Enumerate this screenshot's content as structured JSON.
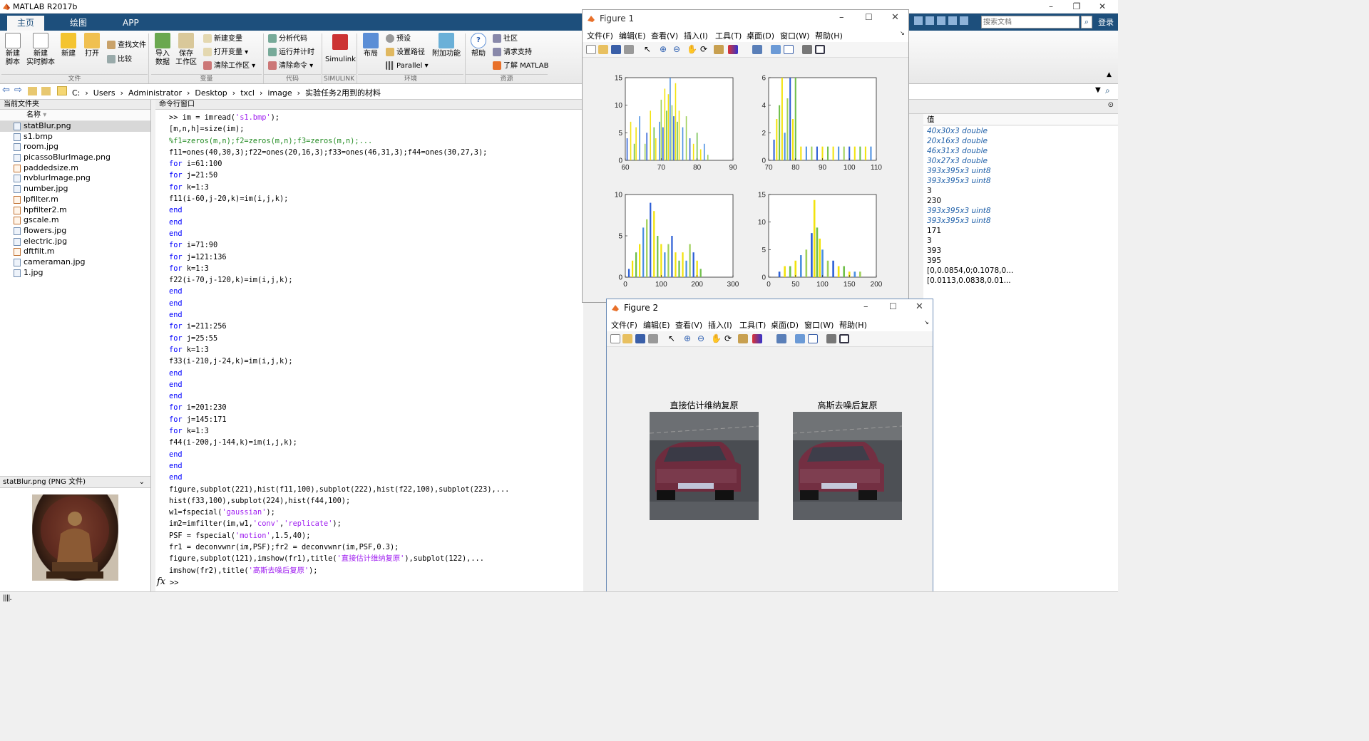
{
  "app": {
    "title": "MATLAB R2017b"
  },
  "ribbon_tabs": [
    "主页",
    "绘图",
    "APP"
  ],
  "ribbon": {
    "groups": [
      "文件",
      "变量",
      "代码",
      "SIMULINK",
      "环境",
      "资源"
    ],
    "big_buttons": [
      {
        "label": "新建\n脚本",
        "icon": "new-script-icon"
      },
      {
        "label": "新建\n实时脚本",
        "icon": "new-live-script-icon"
      },
      {
        "label": "新建",
        "icon": "new-icon"
      },
      {
        "label": "打开",
        "icon": "open-folder-icon"
      },
      {
        "label": "导入\n数据",
        "icon": "import-icon"
      },
      {
        "label": "保存\n工作区",
        "icon": "save-workspace-icon"
      },
      {
        "label": "Simulink",
        "icon": "simulink-icon"
      },
      {
        "label": "布局",
        "icon": "layout-icon"
      },
      {
        "label": "附加功能",
        "icon": "addons-icon"
      },
      {
        "label": "帮助",
        "icon": "help-icon"
      }
    ],
    "small_buttons": {
      "find": "查找文件",
      "compare": "比较",
      "newvar": "新建变量",
      "openvar": "打开变量",
      "clearws": "清除工作区",
      "analyze": "分析代码",
      "runtime": "运行并计时",
      "clearcmd": "清除命令",
      "prefs": "预设",
      "setpath": "设置路径",
      "parallel": "Parallel",
      "community": "社区",
      "support": "请求支持",
      "learn": "了解 MATLAB"
    },
    "search": {
      "placeholder": "搜索文档"
    },
    "login": "登录"
  },
  "address": {
    "crumbs": [
      "C:",
      "Users",
      "Administrator",
      "Desktop",
      "txcl",
      "image",
      "实验任务2用到的材料"
    ]
  },
  "left_panel": {
    "title": "当前文件夹",
    "column": "名称",
    "files": [
      {
        "name": "statBlur.png",
        "selected": true
      },
      {
        "name": "s1.bmp"
      },
      {
        "name": "room.jpg"
      },
      {
        "name": "picassoBlurImage.png"
      },
      {
        "name": "paddedsize.m"
      },
      {
        "name": "nvblurImage.png"
      },
      {
        "name": "number.jpg"
      },
      {
        "name": "lpfilter.m"
      },
      {
        "name": "hpfilter2.m"
      },
      {
        "name": "gscale.m"
      },
      {
        "name": "flowers.jpg"
      },
      {
        "name": "electric.jpg"
      },
      {
        "name": "dftfilt.m"
      },
      {
        "name": "cameraman.jpg"
      },
      {
        "name": "1.jpg"
      }
    ],
    "details_title": "statBlur.png  (PNG 文件)"
  },
  "command_window": {
    "title": "命令行窗口",
    "lines": [
      [
        [
          ">> im = imread(",
          ""
        ],
        [
          "'s1.bmp'",
          "str"
        ],
        [
          ");",
          ""
        ]
      ],
      [
        [
          "[m,n,h]=size(im);",
          ""
        ]
      ],
      [
        [
          "%f1=zeros(m,n);f2=zeros(m,n);f3=zeros(m,n);...",
          "cmt"
        ]
      ],
      [
        [
          "f11=ones(40,30,3);f22=ones(20,16,3);f33=ones(46,31,3);f44=ones(30,27,3);",
          ""
        ]
      ],
      [
        [
          "for ",
          "kw"
        ],
        [
          "i=61:100",
          ""
        ]
      ],
      [
        [
          "for ",
          "kw"
        ],
        [
          "j=21:50",
          ""
        ]
      ],
      [
        [
          "for ",
          "kw"
        ],
        [
          "k=1:3",
          ""
        ]
      ],
      [
        [
          "f11(i-60,j-20,k)=im(i,j,k);",
          ""
        ]
      ],
      [
        [
          "end",
          "kw"
        ]
      ],
      [
        [
          "end",
          "kw"
        ]
      ],
      [
        [
          "end",
          "kw"
        ]
      ],
      [
        [
          "for ",
          "kw"
        ],
        [
          "i=71:90",
          ""
        ]
      ],
      [
        [
          "for ",
          "kw"
        ],
        [
          "j=121:136",
          ""
        ]
      ],
      [
        [
          "for ",
          "kw"
        ],
        [
          "k=1:3",
          ""
        ]
      ],
      [
        [
          "f22(i-70,j-120,k)=im(i,j,k);",
          ""
        ]
      ],
      [
        [
          "end",
          "kw"
        ]
      ],
      [
        [
          "end",
          "kw"
        ]
      ],
      [
        [
          "end",
          "kw"
        ]
      ],
      [
        [
          "for ",
          "kw"
        ],
        [
          "i=211:256",
          ""
        ]
      ],
      [
        [
          "for ",
          "kw"
        ],
        [
          "j=25:55",
          ""
        ]
      ],
      [
        [
          "for ",
          "kw"
        ],
        [
          "k=1:3",
          ""
        ]
      ],
      [
        [
          "f33(i-210,j-24,k)=im(i,j,k);",
          ""
        ]
      ],
      [
        [
          "end",
          "kw"
        ]
      ],
      [
        [
          "end",
          "kw"
        ]
      ],
      [
        [
          "end",
          "kw"
        ]
      ],
      [
        [
          "for ",
          "kw"
        ],
        [
          "i=201:230",
          ""
        ]
      ],
      [
        [
          "for ",
          "kw"
        ],
        [
          "j=145:171",
          ""
        ]
      ],
      [
        [
          "for ",
          "kw"
        ],
        [
          "k=1:3",
          ""
        ]
      ],
      [
        [
          "f44(i-200,j-144,k)=im(i,j,k);",
          ""
        ]
      ],
      [
        [
          "end",
          "kw"
        ]
      ],
      [
        [
          "end",
          "kw"
        ]
      ],
      [
        [
          "end",
          "kw"
        ]
      ],
      [
        [
          "figure,subplot(221),hist(f11,100),subplot(222),hist(f22,100),subplot(223),...",
          ""
        ]
      ],
      [
        [
          "hist(f33,100),subplot(224),hist(f44,100);",
          ""
        ]
      ],
      [
        [
          "w1=fspecial(",
          ""
        ],
        [
          "'gaussian'",
          "str"
        ],
        [
          ");",
          ""
        ]
      ],
      [
        [
          "im2=imfilter(im,w1,",
          ""
        ],
        [
          "'conv'",
          "str"
        ],
        [
          ",",
          ""
        ],
        [
          "'replicate'",
          "str"
        ],
        [
          ");",
          ""
        ]
      ],
      [
        [
          "PSF = fspecial(",
          ""
        ],
        [
          "'motion'",
          "str"
        ],
        [
          ",1.5,40);",
          ""
        ]
      ],
      [
        [
          "fr1 = deconvwnr(im,PSF);fr2 = deconvwnr(im,PSF,0.3);",
          ""
        ]
      ],
      [
        [
          "figure,subplot(121),imshow(fr1),title(",
          ""
        ],
        [
          "'直接估计维纳复原'",
          "str"
        ],
        [
          "),subplot(122),...",
          ""
        ]
      ],
      [
        [
          "imshow(fr2),title(",
          ""
        ],
        [
          "'高斯去噪后复原'",
          "str"
        ],
        [
          ");",
          ""
        ]
      ]
    ],
    "prompt": ">>"
  },
  "workspace": {
    "value_header": "值",
    "values": [
      {
        "v": "40x30x3 double",
        "it": true
      },
      {
        "v": "20x16x3 double",
        "it": true
      },
      {
        "v": "46x31x3 double",
        "it": true
      },
      {
        "v": "30x27x3 double",
        "it": true
      },
      {
        "v": "393x395x3 uint8",
        "it": true
      },
      {
        "v": "393x395x3 uint8",
        "it": true
      },
      {
        "v": "3"
      },
      {
        "v": "230"
      },
      {
        "v": "393x395x3 uint8",
        "it": true
      },
      {
        "v": "393x395x3 uint8",
        "it": true
      },
      {
        "v": "171"
      },
      {
        "v": "3"
      },
      {
        "v": "393"
      },
      {
        "v": "395"
      },
      {
        "v": "[0,0.0854,0;0.1078,0..."
      },
      {
        "v": "[0.0113,0.0838,0.01..."
      }
    ]
  },
  "figure1": {
    "title": "Figure 1",
    "menu": [
      "文件(F)",
      "编辑(E)",
      "查看(V)",
      "插入(I)",
      "工具(T)",
      "桌面(D)",
      "窗口(W)",
      "帮助(H)"
    ]
  },
  "figure2": {
    "title": "Figure 2",
    "menu": [
      "文件(F)",
      "编辑(E)",
      "查看(V)",
      "插入(I)",
      "工具(T)",
      "桌面(D)",
      "窗口(W)",
      "帮助(H)"
    ],
    "titles": [
      "直接估计维纳复原",
      "高斯去噪后复原"
    ]
  },
  "colors": {
    "accent": "#1d4f7c",
    "keyword": "#0000ff",
    "string": "#a020f0",
    "comment": "#228b22",
    "hist_blue": "#2d5fd6",
    "hist_yellow": "#f2e30c",
    "hist_green": "#6fbf4a"
  },
  "chart_data": [
    {
      "type": "bar",
      "subplot": 221,
      "xlim": [
        60,
        90
      ],
      "ylim": [
        0,
        15
      ],
      "xticks": [
        60,
        70,
        80,
        90
      ],
      "yticks": [
        0,
        5,
        10,
        15
      ],
      "x": [
        60.5,
        61.5,
        62.5,
        63,
        64,
        65.5,
        66,
        67,
        68,
        68.5,
        69.5,
        70,
        70.5,
        71,
        71.5,
        72,
        72.5,
        73,
        73.5,
        74,
        74.5,
        75,
        76,
        77,
        78,
        79,
        80,
        81,
        82,
        83
      ],
      "values": [
        4,
        7,
        3,
        6,
        8,
        3,
        5,
        9,
        6,
        4,
        7,
        11,
        6,
        13,
        9,
        12,
        15,
        10,
        8,
        14,
        7,
        9,
        6,
        8,
        4,
        3,
        5,
        2,
        3,
        1
      ]
    },
    {
      "type": "bar",
      "subplot": 222,
      "xlim": [
        70,
        110
      ],
      "ylim": [
        0,
        6
      ],
      "xticks": [
        70,
        80,
        90,
        100,
        110
      ],
      "yticks": [
        0,
        2,
        4,
        6
      ],
      "x": [
        72,
        73,
        74,
        75,
        76,
        77,
        78,
        79,
        80,
        82,
        84,
        86,
        88,
        90,
        92,
        94,
        96,
        98,
        100,
        102,
        104,
        106,
        108
      ],
      "values": [
        1.5,
        3,
        4,
        6,
        2,
        4.5,
        6,
        3,
        6,
        1,
        1,
        1,
        1,
        1,
        1,
        1,
        1,
        1,
        1,
        1,
        1,
        1,
        1
      ]
    },
    {
      "type": "bar",
      "subplot": 223,
      "xlim": [
        0,
        300
      ],
      "ylim": [
        0,
        10
      ],
      "xticks": [
        0,
        100,
        200,
        300
      ],
      "yticks": [
        0,
        5,
        10
      ],
      "x": [
        10,
        20,
        30,
        40,
        50,
        60,
        70,
        80,
        90,
        100,
        110,
        120,
        130,
        140,
        150,
        160,
        170,
        180,
        190,
        200,
        210
      ],
      "values": [
        1,
        2,
        3,
        4,
        6,
        7,
        9,
        8,
        5,
        4,
        3,
        4,
        5,
        3,
        2,
        3,
        2,
        4,
        3,
        2,
        1
      ]
    },
    {
      "type": "bar",
      "subplot": 224,
      "xlim": [
        0,
        200
      ],
      "ylim": [
        0,
        15
      ],
      "xticks": [
        0,
        50,
        100,
        150,
        200
      ],
      "yticks": [
        0,
        5,
        10,
        15
      ],
      "x": [
        20,
        30,
        40,
        50,
        60,
        70,
        80,
        85,
        90,
        95,
        100,
        110,
        120,
        130,
        140,
        150,
        160,
        170
      ],
      "values": [
        1,
        2,
        2,
        3,
        4,
        5,
        8,
        14,
        9,
        7,
        5,
        3,
        3,
        2,
        2,
        1,
        1,
        1
      ]
    }
  ]
}
